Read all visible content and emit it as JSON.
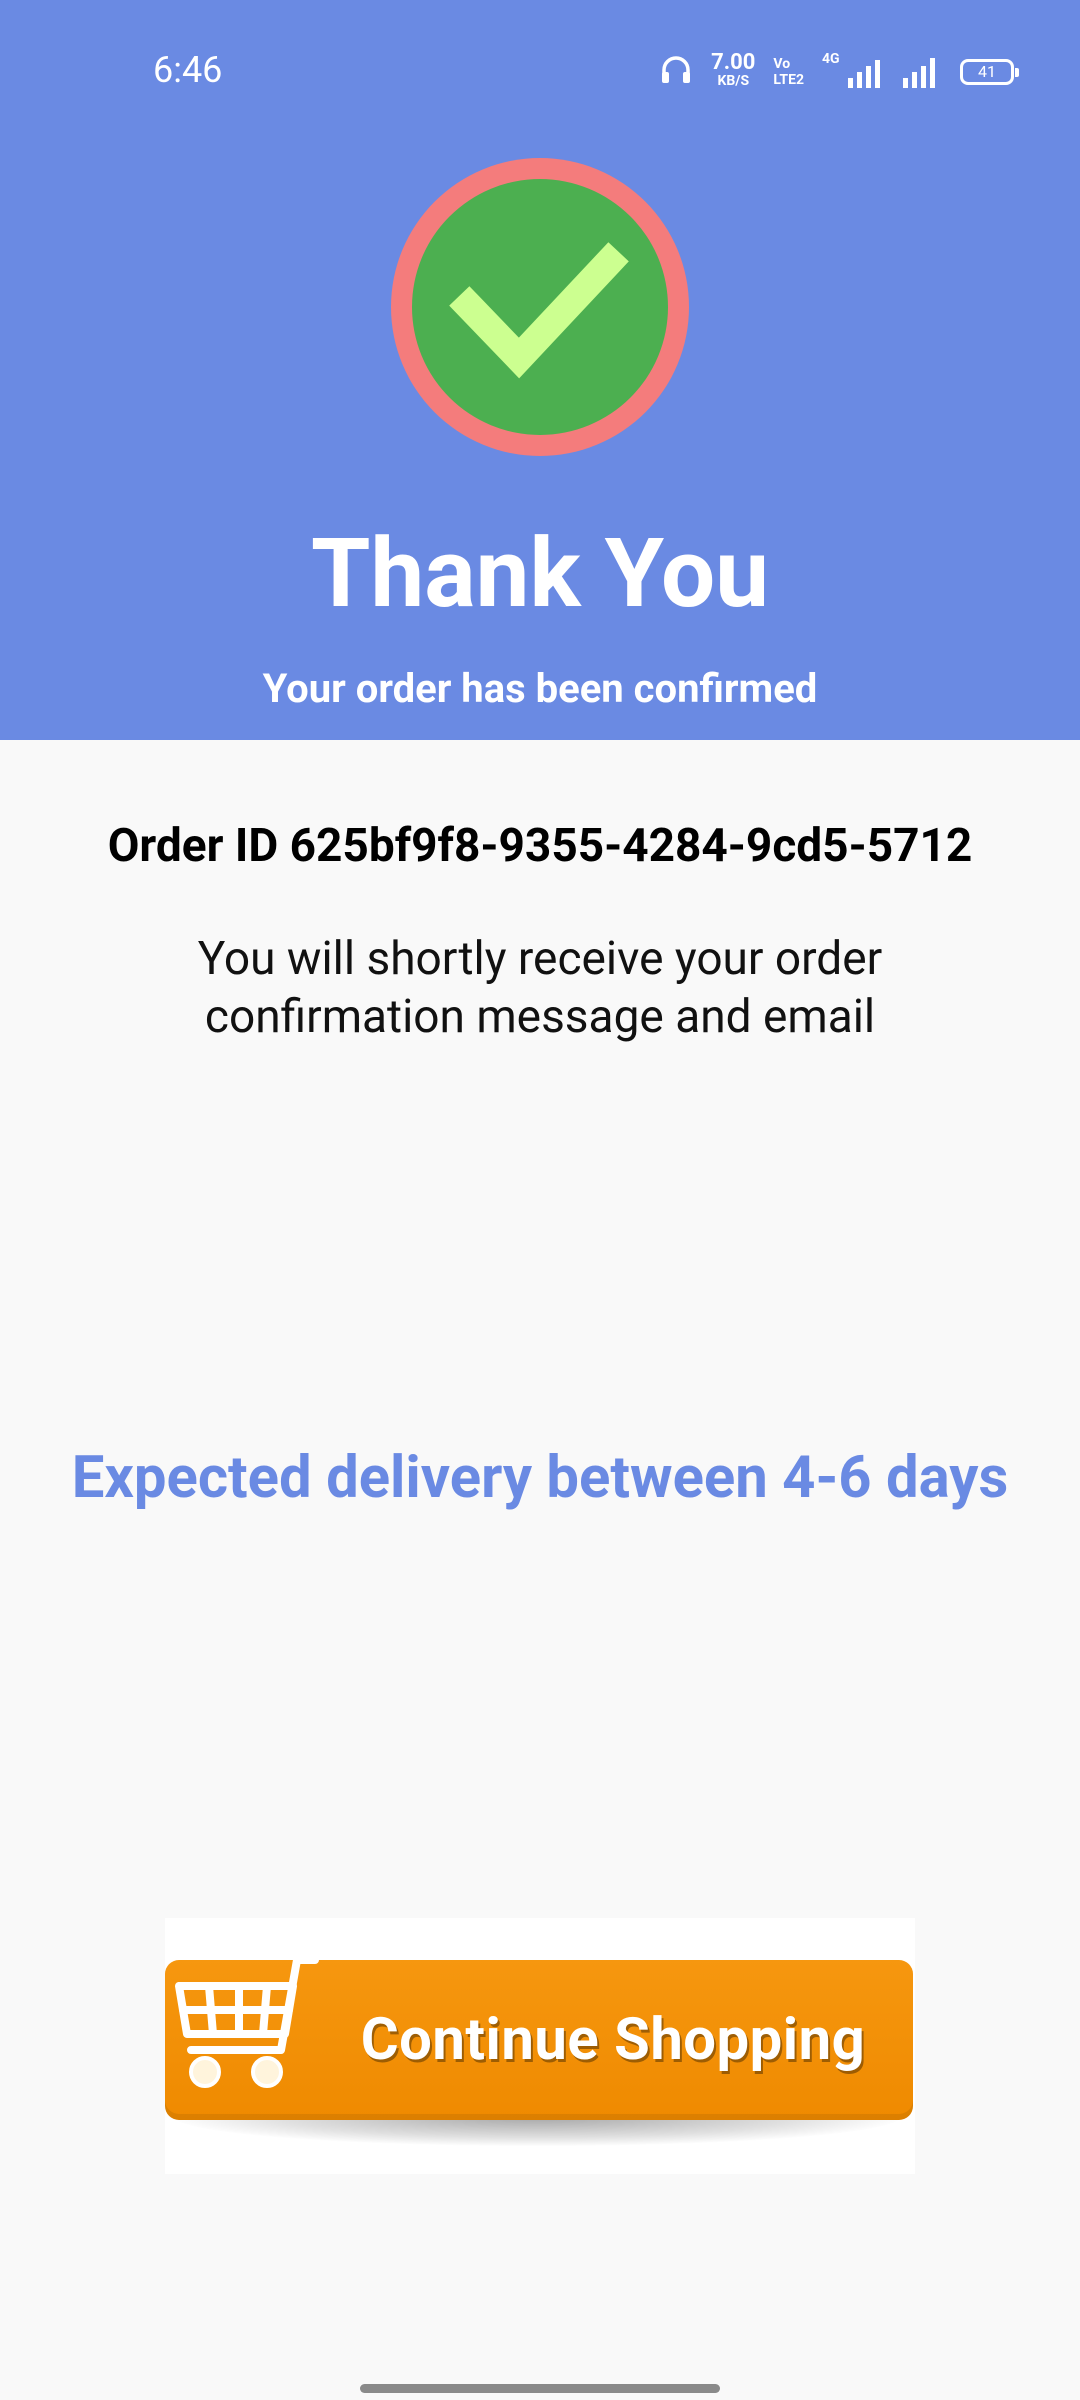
{
  "status_bar": {
    "time": "6:46",
    "net_speed_value": "7.00",
    "net_speed_unit": "KB/S",
    "volte_line1": "Vo",
    "volte_line2": "LTE2",
    "network_tag": "4G",
    "battery_level": "41"
  },
  "header": {
    "title": "Thank You",
    "subtitle": "Your order has been confirmed"
  },
  "order": {
    "id_text": "Order ID 625bf9f8-9355-4284-9cd5-5712",
    "message": "You will shortly receive your order confirmation message and email",
    "delivery_text": "Expected delivery between 4-6 days"
  },
  "actions": {
    "continue_label": "Continue Shopping"
  },
  "colors": {
    "header_bg": "#6a8ae3",
    "check_ring": "#f47c7c",
    "check_fill": "#4caf50",
    "check_mark": "#ccff90",
    "button_orange": "#f39200"
  },
  "icons": {
    "success": "check-circle-icon",
    "cart": "shopping-cart-icon"
  }
}
